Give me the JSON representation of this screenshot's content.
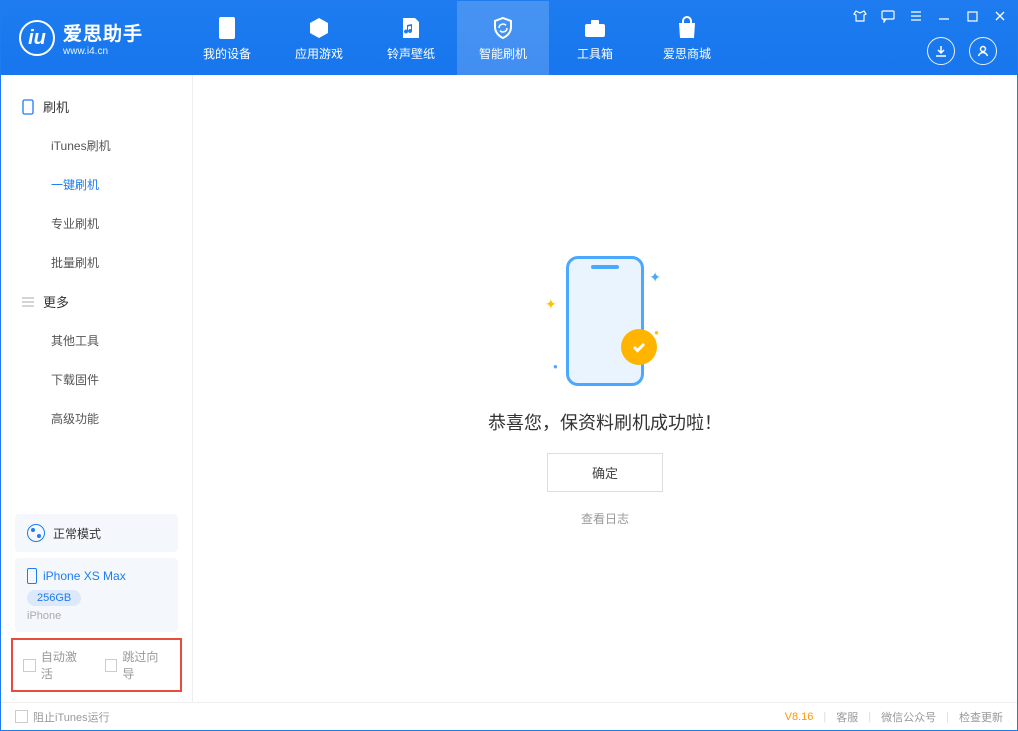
{
  "app": {
    "title": "爱思助手",
    "subtitle": "www.i4.cn"
  },
  "nav": {
    "tabs": [
      {
        "label": "我的设备"
      },
      {
        "label": "应用游戏"
      },
      {
        "label": "铃声壁纸"
      },
      {
        "label": "智能刷机"
      },
      {
        "label": "工具箱"
      },
      {
        "label": "爱思商城"
      }
    ]
  },
  "sidebar": {
    "group1": {
      "title": "刷机",
      "items": [
        "iTunes刷机",
        "一键刷机",
        "专业刷机",
        "批量刷机"
      ],
      "activeIndex": 1
    },
    "group2": {
      "title": "更多",
      "items": [
        "其他工具",
        "下载固件",
        "高级功能"
      ]
    },
    "mode": "正常模式",
    "device": {
      "name": "iPhone XS Max",
      "storage": "256GB",
      "type": "iPhone"
    },
    "checkboxes": {
      "auto_activate": "自动激活",
      "skip_guide": "跳过向导"
    }
  },
  "main": {
    "success_text": "恭喜您，保资料刷机成功啦！",
    "ok_button": "确定",
    "log_link": "查看日志"
  },
  "footer": {
    "block_itunes": "阻止iTunes运行",
    "version": "V8.16",
    "links": [
      "客服",
      "微信公众号",
      "检查更新"
    ]
  }
}
